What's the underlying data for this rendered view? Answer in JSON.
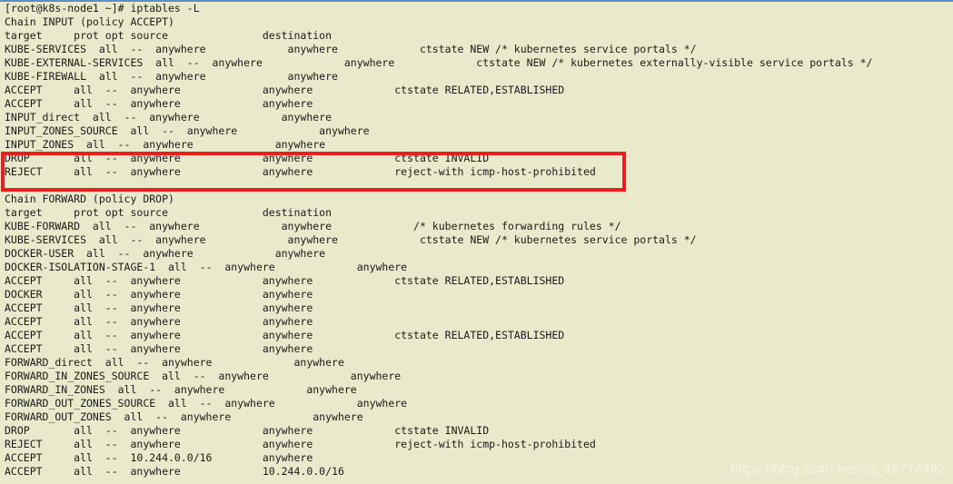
{
  "window": {
    "title": "root@k8s-node1:~ — iptables -L",
    "background_color": "#e9e9cb",
    "text_color": "#1b1b1b",
    "top_border_color": "#5b8fc9"
  },
  "prompt": {
    "user": "root",
    "host": "k8s-node1",
    "cwd": "~",
    "symbol": "#",
    "command": "iptables -L",
    "full_line": "[root@k8s-node1 ~]# iptables -L"
  },
  "terminal_lines": [
    "[root@k8s-node1 ~]# iptables -L",
    "Chain INPUT (policy ACCEPT)",
    "target     prot opt source               destination",
    "KUBE-SERVICES  all  --  anywhere             anywhere             ctstate NEW /* kubernetes service portals */",
    "KUBE-EXTERNAL-SERVICES  all  --  anywhere             anywhere             ctstate NEW /* kubernetes externally-visible service portals */",
    "KUBE-FIREWALL  all  --  anywhere             anywhere",
    "ACCEPT     all  --  anywhere             anywhere             ctstate RELATED,ESTABLISHED",
    "ACCEPT     all  --  anywhere             anywhere",
    "INPUT_direct  all  --  anywhere             anywhere",
    "INPUT_ZONES_SOURCE  all  --  anywhere             anywhere",
    "INPUT_ZONES  all  --  anywhere             anywhere",
    "DROP       all  --  anywhere             anywhere             ctstate INVALID",
    "REJECT     all  --  anywhere             anywhere             reject-with icmp-host-prohibited",
    "",
    "Chain FORWARD (policy DROP)",
    "target     prot opt source               destination",
    "KUBE-FORWARD  all  --  anywhere             anywhere             /* kubernetes forwarding rules */",
    "KUBE-SERVICES  all  --  anywhere             anywhere             ctstate NEW /* kubernetes service portals */",
    "DOCKER-USER  all  --  anywhere             anywhere",
    "DOCKER-ISOLATION-STAGE-1  all  --  anywhere             anywhere",
    "ACCEPT     all  --  anywhere             anywhere             ctstate RELATED,ESTABLISHED",
    "DOCKER     all  --  anywhere             anywhere",
    "ACCEPT     all  --  anywhere             anywhere",
    "ACCEPT     all  --  anywhere             anywhere",
    "ACCEPT     all  --  anywhere             anywhere             ctstate RELATED,ESTABLISHED",
    "ACCEPT     all  --  anywhere             anywhere",
    "FORWARD_direct  all  --  anywhere             anywhere",
    "FORWARD_IN_ZONES_SOURCE  all  --  anywhere             anywhere",
    "FORWARD_IN_ZONES  all  --  anywhere             anywhere",
    "FORWARD_OUT_ZONES_SOURCE  all  --  anywhere             anywhere",
    "FORWARD_OUT_ZONES  all  --  anywhere             anywhere",
    "DROP       all  --  anywhere             anywhere             ctstate INVALID",
    "REJECT     all  --  anywhere             anywhere             reject-with icmp-host-prohibited",
    "ACCEPT     all  --  10.244.0.0/16        anywhere",
    "ACCEPT     all  --  anywhere             10.244.0.0/16"
  ],
  "chains": [
    {
      "name": "INPUT",
      "policy": "ACCEPT",
      "header_line": "Chain INPUT (policy ACCEPT)",
      "columns": [
        "target",
        "prot",
        "opt",
        "source",
        "destination",
        ""
      ],
      "rules": [
        {
          "target": "KUBE-SERVICES",
          "prot": "all",
          "opt": "--",
          "source": "anywhere",
          "destination": "anywhere",
          "extra": "ctstate NEW /* kubernetes service portals */"
        },
        {
          "target": "KUBE-EXTERNAL-SERVICES",
          "prot": "all",
          "opt": "--",
          "source": "anywhere",
          "destination": "anywhere",
          "extra": "ctstate NEW /* kubernetes externally-visible service portals */"
        },
        {
          "target": "KUBE-FIREWALL",
          "prot": "all",
          "opt": "--",
          "source": "anywhere",
          "destination": "anywhere",
          "extra": ""
        },
        {
          "target": "ACCEPT",
          "prot": "all",
          "opt": "--",
          "source": "anywhere",
          "destination": "anywhere",
          "extra": "ctstate RELATED,ESTABLISHED"
        },
        {
          "target": "ACCEPT",
          "prot": "all",
          "opt": "--",
          "source": "anywhere",
          "destination": "anywhere",
          "extra": ""
        },
        {
          "target": "INPUT_direct",
          "prot": "all",
          "opt": "--",
          "source": "anywhere",
          "destination": "anywhere",
          "extra": ""
        },
        {
          "target": "INPUT_ZONES_SOURCE",
          "prot": "all",
          "opt": "--",
          "source": "anywhere",
          "destination": "anywhere",
          "extra": ""
        },
        {
          "target": "INPUT_ZONES",
          "prot": "all",
          "opt": "--",
          "source": "anywhere",
          "destination": "anywhere",
          "extra": ""
        },
        {
          "target": "DROP",
          "prot": "all",
          "opt": "--",
          "source": "anywhere",
          "destination": "anywhere",
          "extra": "ctstate INVALID",
          "highlighted": true
        },
        {
          "target": "REJECT",
          "prot": "all",
          "opt": "--",
          "source": "anywhere",
          "destination": "anywhere",
          "extra": "reject-with icmp-host-prohibited",
          "highlighted": true
        }
      ]
    },
    {
      "name": "FORWARD",
      "policy": "DROP",
      "header_line": "Chain FORWARD (policy DROP)",
      "columns": [
        "target",
        "prot",
        "opt",
        "source",
        "destination",
        ""
      ],
      "rules": [
        {
          "target": "KUBE-FORWARD",
          "prot": "all",
          "opt": "--",
          "source": "anywhere",
          "destination": "anywhere",
          "extra": "/* kubernetes forwarding rules */"
        },
        {
          "target": "KUBE-SERVICES",
          "prot": "all",
          "opt": "--",
          "source": "anywhere",
          "destination": "anywhere",
          "extra": "ctstate NEW /* kubernetes service portals */"
        },
        {
          "target": "DOCKER-USER",
          "prot": "all",
          "opt": "--",
          "source": "anywhere",
          "destination": "anywhere",
          "extra": ""
        },
        {
          "target": "DOCKER-ISOLATION-STAGE-1",
          "prot": "all",
          "opt": "--",
          "source": "anywhere",
          "destination": "anywhere",
          "extra": ""
        },
        {
          "target": "ACCEPT",
          "prot": "all",
          "opt": "--",
          "source": "anywhere",
          "destination": "anywhere",
          "extra": "ctstate RELATED,ESTABLISHED"
        },
        {
          "target": "DOCKER",
          "prot": "all",
          "opt": "--",
          "source": "anywhere",
          "destination": "anywhere",
          "extra": ""
        },
        {
          "target": "ACCEPT",
          "prot": "all",
          "opt": "--",
          "source": "anywhere",
          "destination": "anywhere",
          "extra": ""
        },
        {
          "target": "ACCEPT",
          "prot": "all",
          "opt": "--",
          "source": "anywhere",
          "destination": "anywhere",
          "extra": ""
        },
        {
          "target": "ACCEPT",
          "prot": "all",
          "opt": "--",
          "source": "anywhere",
          "destination": "anywhere",
          "extra": "ctstate RELATED,ESTABLISHED"
        },
        {
          "target": "ACCEPT",
          "prot": "all",
          "opt": "--",
          "source": "anywhere",
          "destination": "anywhere",
          "extra": ""
        },
        {
          "target": "FORWARD_direct",
          "prot": "all",
          "opt": "--",
          "source": "anywhere",
          "destination": "anywhere",
          "extra": ""
        },
        {
          "target": "FORWARD_IN_ZONES_SOURCE",
          "prot": "all",
          "opt": "--",
          "source": "anywhere",
          "destination": "anywhere",
          "extra": ""
        },
        {
          "target": "FORWARD_IN_ZONES",
          "prot": "all",
          "opt": "--",
          "source": "anywhere",
          "destination": "anywhere",
          "extra": ""
        },
        {
          "target": "FORWARD_OUT_ZONES_SOURCE",
          "prot": "all",
          "opt": "--",
          "source": "anywhere",
          "destination": "anywhere",
          "extra": ""
        },
        {
          "target": "FORWARD_OUT_ZONES",
          "prot": "all",
          "opt": "--",
          "source": "anywhere",
          "destination": "anywhere",
          "extra": ""
        },
        {
          "target": "DROP",
          "prot": "all",
          "opt": "--",
          "source": "anywhere",
          "destination": "anywhere",
          "extra": "ctstate INVALID"
        },
        {
          "target": "REJECT",
          "prot": "all",
          "opt": "--",
          "source": "anywhere",
          "destination": "anywhere",
          "extra": "reject-with icmp-host-prohibited"
        },
        {
          "target": "ACCEPT",
          "prot": "all",
          "opt": "--",
          "source": "10.244.0.0/16",
          "destination": "anywhere",
          "extra": ""
        },
        {
          "target": "ACCEPT",
          "prot": "all",
          "opt": "--",
          "source": "anywhere",
          "destination": "10.244.0.0/16",
          "extra": ""
        }
      ]
    }
  ],
  "annotation": {
    "type": "rectangle-highlight",
    "color": "#ee1d1d",
    "covers_lines": [
      "DROP       all  --  anywhere             anywhere             ctstate INVALID",
      "REJECT     all  --  anywhere             anywhere             reject-with icmp-host-prohibited"
    ]
  },
  "watermark": {
    "text": "https://blog.csdn.net/qq_38774492",
    "color": "#f2f2e0"
  }
}
